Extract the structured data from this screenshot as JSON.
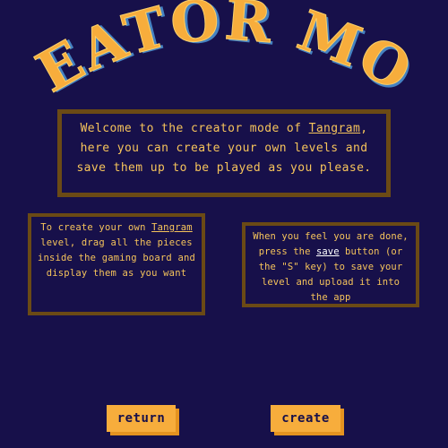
{
  "title": "CREATOR MODE",
  "colors": {
    "background": "#17104a",
    "accent": "#f7ad3c",
    "panel_border": "#6b4a15",
    "text": "#f6c45b",
    "title_shadow": "#4b8fd0"
  },
  "intro": {
    "before": "Welcome to the creator mode of ",
    "link": "Tangram",
    "after": ", here you can create your own levels and save them up to be played as you please."
  },
  "left_panel": {
    "before": "To create your own ",
    "link": "Tangram",
    "after": " level, drag all the pieces inside the gaming board and display them as you want"
  },
  "right_panel": {
    "before": "When you feel you are done, press the ",
    "link": "save",
    "after": " button (or the \"S\" key) to save your level and upload it into the app"
  },
  "buttons": {
    "return_label": "return",
    "create_label": "create"
  }
}
